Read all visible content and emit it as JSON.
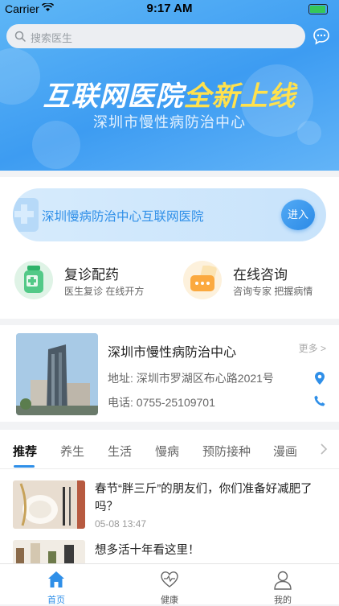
{
  "status_bar": {
    "carrier": "Carrier",
    "time": "9:17 AM"
  },
  "search": {
    "placeholder": "搜索医生"
  },
  "hero": {
    "title_a": "互联网医院",
    "title_b": "全新上线",
    "subtitle": "深圳市慢性病防治中心"
  },
  "banner": {
    "text": "深圳慢病防治中心互联网医院",
    "enter_label": "进入"
  },
  "services": [
    {
      "title": "复诊配药",
      "desc": "医生复诊 在线开方",
      "icon": "medicine-bottle-icon"
    },
    {
      "title": "在线咨询",
      "desc": "咨询专家 把握病情",
      "icon": "consult-chat-icon"
    }
  ],
  "center": {
    "name": "深圳市慢性病防治中心",
    "more": "更多 >",
    "address": "地址: 深圳市罗湖区布心路2021号",
    "phone": "电话: 0755-25109701"
  },
  "tabs": [
    "推荐",
    "养生",
    "生活",
    "慢病",
    "预防接种",
    "漫画"
  ],
  "articles": [
    {
      "title": "春节“胖三斤”的朋友们，你们准备好减肥了吗？",
      "date": "05-08 13:47"
    },
    {
      "title": "想多活十年看这里！",
      "date": ""
    }
  ],
  "tabbar": [
    {
      "label": "首页"
    },
    {
      "label": "健康"
    },
    {
      "label": "我的"
    }
  ],
  "colors": {
    "accent": "#2f8fe8",
    "hero_blue": "#3d9cf2",
    "highlight_yellow": "#ffe14d"
  }
}
